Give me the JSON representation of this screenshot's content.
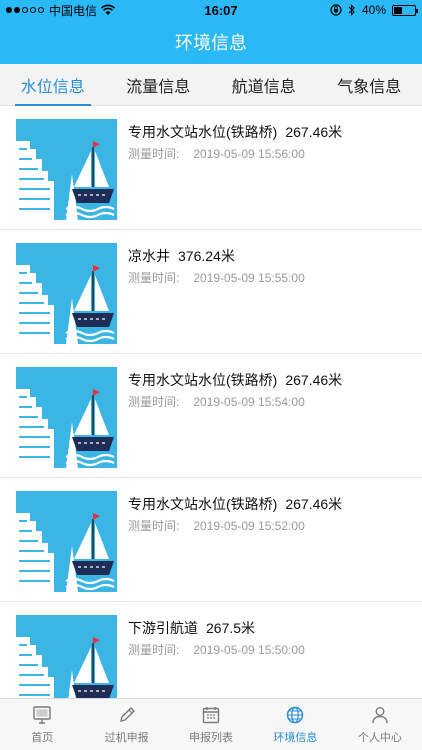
{
  "status_bar": {
    "carrier": "中国电信",
    "time": "16:07",
    "battery": "40%",
    "battery_level": 0.4
  },
  "header": {
    "title": "环境信息"
  },
  "tabs": [
    {
      "label": "水位信息",
      "active": true
    },
    {
      "label": "流量信息",
      "active": false
    },
    {
      "label": "航道信息",
      "active": false
    },
    {
      "label": "气象信息",
      "active": false
    }
  ],
  "items": [
    {
      "name": "专用水文站水位(铁路桥)",
      "value": "267.46米",
      "time_label": "测量时间:",
      "time": "2019-05-09 15:56:00"
    },
    {
      "name": "凉水井",
      "value": "376.24米",
      "time_label": "测量时间:",
      "time": "2019-05-09 15:55:00"
    },
    {
      "name": "专用水文站水位(铁路桥)",
      "value": "267.46米",
      "time_label": "测量时间:",
      "time": "2019-05-09 15:54:00"
    },
    {
      "name": "专用水文站水位(铁路桥)",
      "value": "267.46米",
      "time_label": "测量时间:",
      "time": "2019-05-09 15:52:00"
    },
    {
      "name": "下游引航道",
      "value": "267.5米",
      "time_label": "测量时间:",
      "time": "2019-05-09 15:50:00"
    }
  ],
  "tabbar": [
    {
      "label": "首页",
      "icon": "monitor-icon",
      "active": false
    },
    {
      "label": "过机申报",
      "icon": "pencil-icon",
      "active": false
    },
    {
      "label": "申报列表",
      "icon": "calendar-icon",
      "active": false
    },
    {
      "label": "环境信息",
      "icon": "globe-icon",
      "active": true
    },
    {
      "label": "个人中心",
      "icon": "person-icon",
      "active": false
    }
  ],
  "colors": {
    "header_blue": "#2bb8f6",
    "tab_active": "#2a8fd8",
    "thumb_bg": "#3bb5e3",
    "flag_red": "#e8303a",
    "hull_navy": "#1d2d58"
  }
}
